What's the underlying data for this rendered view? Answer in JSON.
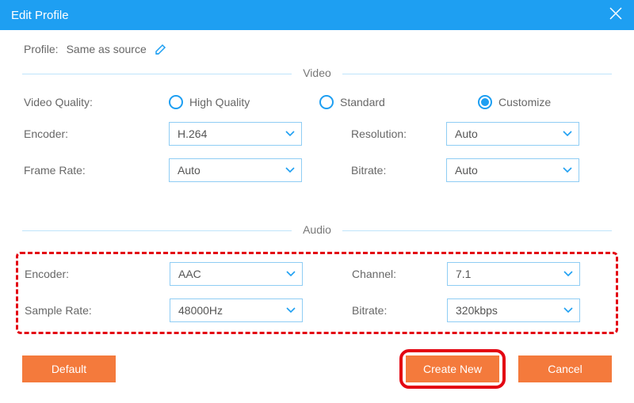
{
  "titlebar": {
    "title": "Edit Profile"
  },
  "profile": {
    "label": "Profile:",
    "value": "Same as source"
  },
  "sections": {
    "video": "Video",
    "audio": "Audio"
  },
  "labels": {
    "videoQuality": "Video Quality:",
    "encoder": "Encoder:",
    "frameRate": "Frame Rate:",
    "resolution": "Resolution:",
    "bitrate": "Bitrate:",
    "sampleRate": "Sample Rate:",
    "channel": "Channel:"
  },
  "radios": {
    "highQuality": "High Quality",
    "standard": "Standard",
    "customize": "Customize"
  },
  "video": {
    "encoder": "H.264",
    "frameRate": "Auto",
    "resolution": "Auto",
    "bitrate": "Auto"
  },
  "audio": {
    "encoder": "AAC",
    "sampleRate": "48000Hz",
    "channel": "7.1",
    "bitrate": "320kbps"
  },
  "buttons": {
    "default": "Default",
    "createNew": "Create New",
    "cancel": "Cancel"
  }
}
